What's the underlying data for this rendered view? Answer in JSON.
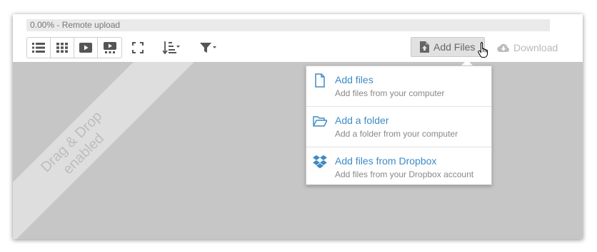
{
  "status": {
    "progress_text": "0.00% - Remote upload"
  },
  "toolbar": {
    "icons": [
      "list-view-icon",
      "grid-view-icon",
      "play-icon",
      "slideshow-icon",
      "fullscreen-icon",
      "sort-icon",
      "filter-icon"
    ],
    "add_files_label": "Add Files",
    "download_label": "Download"
  },
  "droparea": {
    "ribbon_line1": "Drag & Drop",
    "ribbon_line2": "enabled"
  },
  "menu": {
    "items": [
      {
        "title": "Add files",
        "subtitle": "Add files from your computer",
        "icon": "file-icon"
      },
      {
        "title": "Add a folder",
        "subtitle": "Add a folder from your computer",
        "icon": "folder-open-icon"
      },
      {
        "title": "Add files from Dropbox",
        "subtitle": "Add files from your Dropbox account",
        "icon": "dropbox-icon"
      }
    ]
  },
  "colors": {
    "accent": "#3d8ac6",
    "droparea": "#c6c6c6",
    "ribbon": "#dedede"
  }
}
